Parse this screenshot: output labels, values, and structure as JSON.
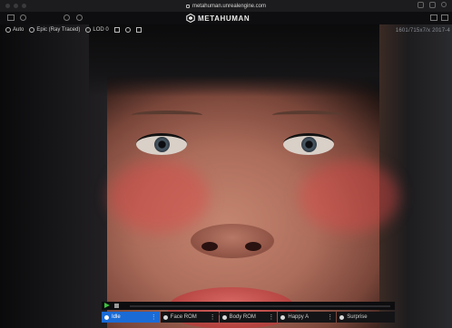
{
  "browser": {
    "url": "metahuman.unrealengine.com"
  },
  "app": {
    "brand": "METAHUMAN"
  },
  "toolbar": {
    "items": [
      {
        "label": "Auto",
        "icon": "gear-icon"
      },
      {
        "label": "Epic (Ray Traced)",
        "icon": "gear-icon"
      },
      {
        "label": "LOD 0",
        "icon": "gear-icon"
      }
    ]
  },
  "stats": {
    "text": "1601/715x7/x 2017-4"
  },
  "player": {
    "clips": [
      {
        "label": "Idle",
        "active": true
      },
      {
        "label": "Face ROM",
        "active": false
      },
      {
        "label": "Body ROM",
        "active": false
      },
      {
        "label": "Happy A",
        "active": false
      },
      {
        "label": "Surprise",
        "active": false
      }
    ],
    "play_color": "#3ec03e",
    "accent": "#1a6bd6"
  }
}
